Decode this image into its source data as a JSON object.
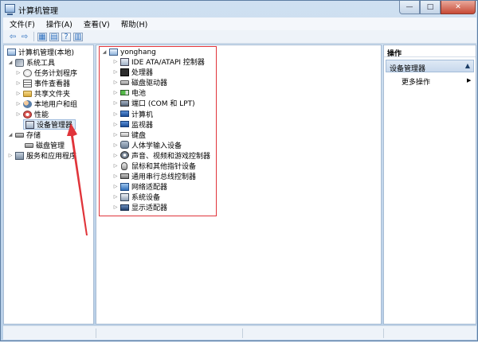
{
  "window": {
    "title": "计算机管理"
  },
  "title_buttons": {
    "minimize": "—",
    "maximize": "□",
    "close": "✕"
  },
  "menu": [
    "文件(F)",
    "操作(A)",
    "查看(V)",
    "帮助(H)"
  ],
  "toolbar": {
    "back": "⇦",
    "forward": "⇨",
    "show_tree": "▦",
    "properties": "▤",
    "help": "?",
    "tool5": "▥"
  },
  "tree": {
    "root": "计算机管理(本地)",
    "system_tools": "系统工具",
    "task_scheduler": "任务计划程序",
    "event_viewer": "事件查看器",
    "shared_folders": "共享文件夹",
    "local_users": "本地用户和组",
    "performance": "性能",
    "device_manager": "设备管理器",
    "storage": "存储",
    "disk_management": "磁盘管理",
    "services_apps": "服务和应用程序"
  },
  "devices": {
    "host": "yonghang",
    "items": [
      "IDE ATA/ATAPI 控制器",
      "处理器",
      "磁盘驱动器",
      "电池",
      "端口 (COM 和 LPT)",
      "计算机",
      "监视器",
      "键盘",
      "人体学输入设备",
      "声音、视频和游戏控制器",
      "鼠标和其他指针设备",
      "通用串行总线控制器",
      "网络适配器",
      "系统设备",
      "显示适配器"
    ],
    "icons": [
      "ide-controller-icon",
      "processor-icon",
      "disk-drive-icon",
      "battery-icon",
      "port-icon",
      "computer-icon",
      "monitor-icon",
      "keyboard-icon",
      "hid-icon",
      "audio-icon",
      "mouse-icon",
      "usb-icon",
      "network-adapter-icon",
      "system-device-icon",
      "display-adapter-icon"
    ]
  },
  "actions": {
    "header": "操作",
    "section": "设备管理器",
    "more": "更多操作"
  },
  "colors": {
    "annotation_red": "#e0343a",
    "selection": "#dde9f6"
  }
}
